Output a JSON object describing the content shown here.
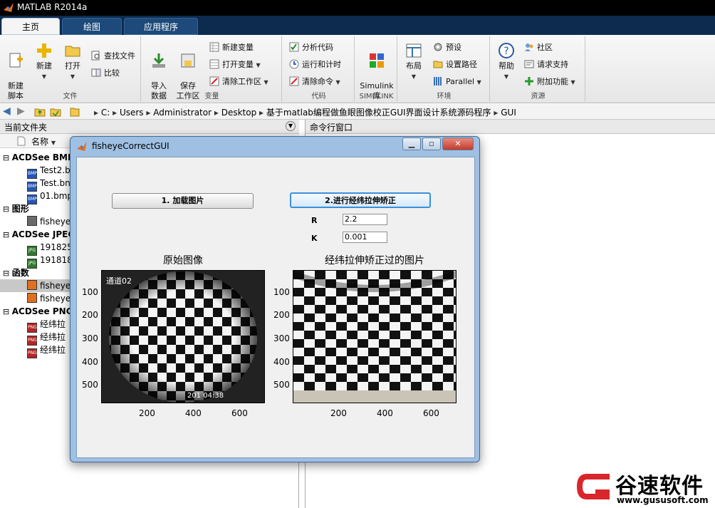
{
  "app": {
    "title": "MATLAB R2014a"
  },
  "tabs": [
    {
      "label": "主页"
    },
    {
      "label": "绘图"
    },
    {
      "label": "应用程序"
    }
  ],
  "ribbon": {
    "file": {
      "group": "文件",
      "new_script": "新建\n脚本",
      "new": "新建",
      "open": "打开",
      "find_files": "查找文件",
      "compare": "比较"
    },
    "variable": {
      "group": "变量",
      "import": "导入\n数据",
      "save_ws": "保存\n工作区",
      "new_var": "新建变量",
      "open_var": "打开变量",
      "clear_ws": "清除工作区"
    },
    "code": {
      "group": "代码",
      "analyze": "分析代码",
      "run_time": "运行和计时",
      "clear_cmd": "清除命令"
    },
    "simulink": {
      "group": "SIMULINK",
      "lib": "Simulink\n库"
    },
    "env": {
      "group": "环境",
      "layout": "布局",
      "prefs": "预设",
      "set_path": "设置路径",
      "parallel": "Parallel"
    },
    "resources": {
      "group": "资源",
      "help": "帮助",
      "community": "社区",
      "request_support": "请求支持",
      "addons": "附加功能"
    }
  },
  "address": {
    "crumbs": [
      "C:",
      "Users",
      "Administrator",
      "Desktop",
      "基于matlab编程做鱼眼图像校正GUI界面设计系统源码程序",
      "GUI"
    ]
  },
  "left_panel": {
    "title": "当前文件夹",
    "col_name": "名称",
    "rows": [
      {
        "text": "ACDSee BMP",
        "kind": "group"
      },
      {
        "text": "Test2.b",
        "kind": "bmp"
      },
      {
        "text": "Test.bn",
        "kind": "bmp"
      },
      {
        "text": "01.bmp",
        "kind": "bmp"
      },
      {
        "text": "图形",
        "kind": "group"
      },
      {
        "text": "fisheye",
        "kind": "fig"
      },
      {
        "text": "ACDSee JPEG",
        "kind": "group"
      },
      {
        "text": "191825",
        "kind": "jpg"
      },
      {
        "text": "191818",
        "kind": "jpg"
      },
      {
        "text": "函数",
        "kind": "group"
      },
      {
        "text": "fisheye",
        "kind": "m"
      },
      {
        "text": "fisheye",
        "kind": "m"
      },
      {
        "text": "ACDSee PNG",
        "kind": "group"
      },
      {
        "text": "经纬拉",
        "kind": "png"
      },
      {
        "text": "经纬拉",
        "kind": "png"
      },
      {
        "text": "经纬拉",
        "kind": "png"
      }
    ]
  },
  "cmd_panel": {
    "title": "命令行窗口"
  },
  "gui": {
    "title": "fisheyeCorrectGUI",
    "load_button": "1. 加载图片",
    "correct_button": "2.进行经纬拉伸矫正",
    "r_label": "R",
    "r_value": "2.2",
    "k_label": "K",
    "k_value": "0.001",
    "axes_left_title": "原始图像",
    "axes_right_title": "经纬拉伸矫正过的图片",
    "left_overlay_top": "通道02",
    "left_overlay_bottom": "201   04:38",
    "y_ticks": [
      "100",
      "200",
      "300",
      "400",
      "500"
    ],
    "x_ticks": [
      "200",
      "400",
      "600"
    ]
  },
  "watermark": {
    "brand": "谷速软件",
    "url": "www.gususoft.com"
  },
  "colors": {
    "accent": "#1d4a7a",
    "brand_red": "#d9262c"
  }
}
